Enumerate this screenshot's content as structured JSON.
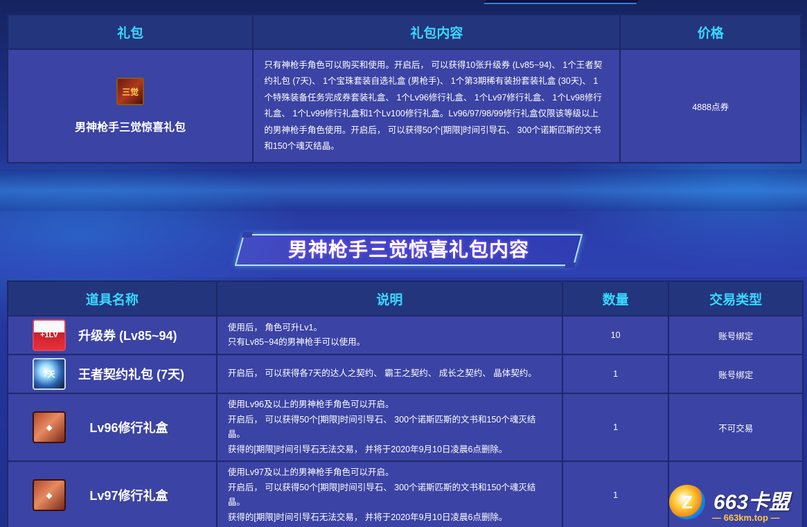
{
  "top_table": {
    "headers": [
      "礼包",
      "礼包内容",
      "价格"
    ],
    "package": {
      "name": "男神枪手三觉惊喜礼包",
      "content": "只有神枪手角色可以购买和使用。开启后， 可以获得10张升级券 (Lv85~94)、 1个王者契约礼包 (7天)、 1个宝珠套装自选礼盒 (男枪手)、 1个第3期稀有装扮套装礼盒 (30天)、 1个特殊装备任务完成券套装礼盒、 1个Lv96修行礼盒、 1个Lv97修行礼盒、 1个Lv98修行礼盒、 1个Lv99修行礼盒和1个Lv100修行礼盒。Lv96/97/98/99修行礼盒仅限该等级以上的男神枪手角色使用。开启后， 可以获得50个[期限]时间引导石、 300个诺斯匹斯的文书和150个魂灭结晶。",
      "price": "4888点券",
      "icon": "gift-pack-icon"
    }
  },
  "banner": {
    "title": "男神枪手三觉惊喜礼包内容"
  },
  "items_table": {
    "headers": [
      "道具名称",
      "说明",
      "数量",
      "交易类型"
    ],
    "rows": [
      {
        "name": "升级券 (Lv85~94)",
        "icon": "level-up-ticket-icon",
        "desc": [
          "使用后， 角色可升Lv1。",
          "只有Lv85~94的男神枪手可以使用。"
        ],
        "qty": "10",
        "trade": "账号绑定"
      },
      {
        "name": "王者契约礼包 (7天)",
        "icon": "king-contract-icon",
        "desc": [
          "开启后， 可以获得各7天的达人之契约、 霸王之契约、 成长之契约、 晶体契约。"
        ],
        "qty": "1",
        "trade": "账号绑定"
      },
      {
        "name": "Lv96修行礼盒",
        "icon": "training-box-icon",
        "desc": [
          "使用Lv96及以上的男神枪手角色可以开启。",
          "开启后， 可以获得50个[期限]时间引导石、 300个诺斯匹斯的文书和150个魂灭结晶。",
          "获得的[期限]时间引导石无法交易， 并将于2020年9月10日凌晨6点删除。"
        ],
        "qty": "1",
        "trade": "不可交易"
      },
      {
        "name": "Lv97修行礼盒",
        "icon": "training-box-icon",
        "desc": [
          "使用Lv97及以上的男神枪手角色可以开启。",
          "开启后， 可以获得50个[期限]时间引导石、 300个诺斯匹斯的文书和150个魂灭结晶。",
          "获得的[期限]时间引导石无法交易， 并将于2020年9月10日凌晨6点删除。"
        ],
        "qty": "1",
        "trade": ""
      }
    ]
  },
  "watermark": {
    "brand": "663卡盟",
    "url": "— 663km.top —"
  },
  "colors": {
    "header_text": "#38d9ff",
    "header_bg": "#23357d",
    "cell_bg": "#3b43a4",
    "border": "#1d2869"
  }
}
